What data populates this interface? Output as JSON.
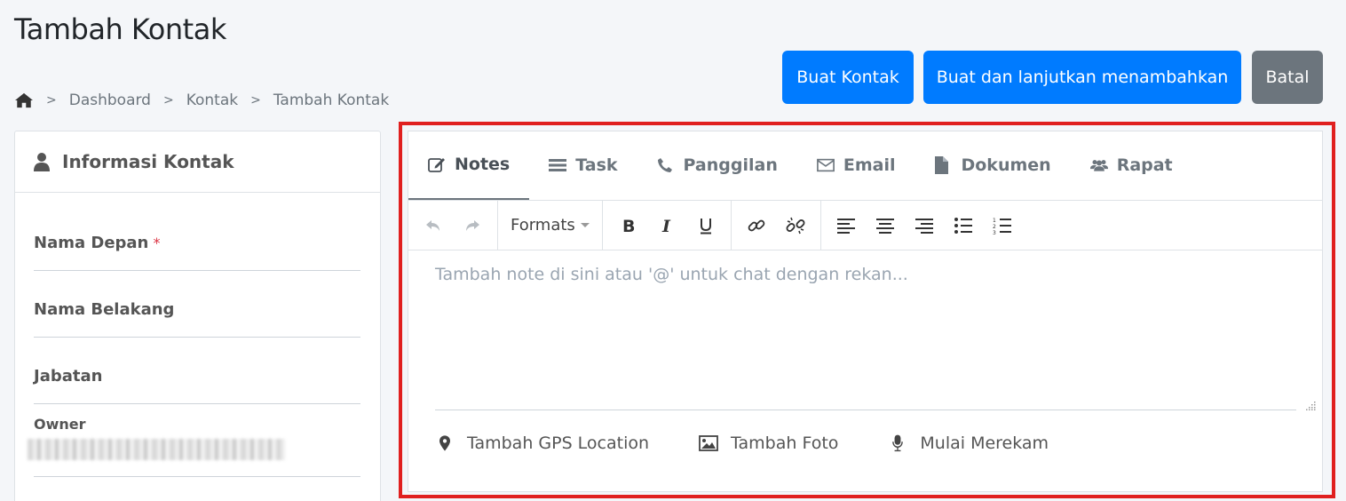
{
  "page": {
    "title": "Tambah Kontak"
  },
  "breadcrumb": {
    "home_icon": "home-icon",
    "items": [
      "Dashboard",
      "Kontak",
      "Tambah Kontak"
    ],
    "separator": ">"
  },
  "actions": {
    "create": "Buat Kontak",
    "create_continue": "Buat dan lanjutkan menambahkan",
    "cancel": "Batal"
  },
  "colors": {
    "primary": "#007bff",
    "secondary": "#6c757d",
    "highlight": "#e0201f",
    "required": "#dc3545"
  },
  "contact_info": {
    "header_icon": "user-icon",
    "header": "Informasi Kontak",
    "fields": {
      "first_name": "Nama Depan",
      "required_mark": "*",
      "last_name": "Nama Belakang",
      "position": "Jabatan",
      "owner": "Owner"
    }
  },
  "tabs": [
    {
      "label": "Notes",
      "icon": "edit-icon",
      "active": true
    },
    {
      "label": "Task",
      "icon": "list-icon",
      "active": false
    },
    {
      "label": "Panggilan",
      "icon": "phone-icon",
      "active": false
    },
    {
      "label": "Email",
      "icon": "envelope-icon",
      "active": false
    },
    {
      "label": "Dokumen",
      "icon": "document-icon",
      "active": false
    },
    {
      "label": "Rapat",
      "icon": "users-icon",
      "active": false
    }
  ],
  "editor": {
    "formats_label": "Formats",
    "placeholder": "Tambah note di sini atau '@' untuk chat dengan rekan...",
    "actions": [
      {
        "label": "Tambah GPS Location",
        "icon": "map-marker-icon"
      },
      {
        "label": "Tambah Foto",
        "icon": "image-icon"
      },
      {
        "label": "Mulai Merekam",
        "icon": "microphone-icon"
      }
    ]
  }
}
